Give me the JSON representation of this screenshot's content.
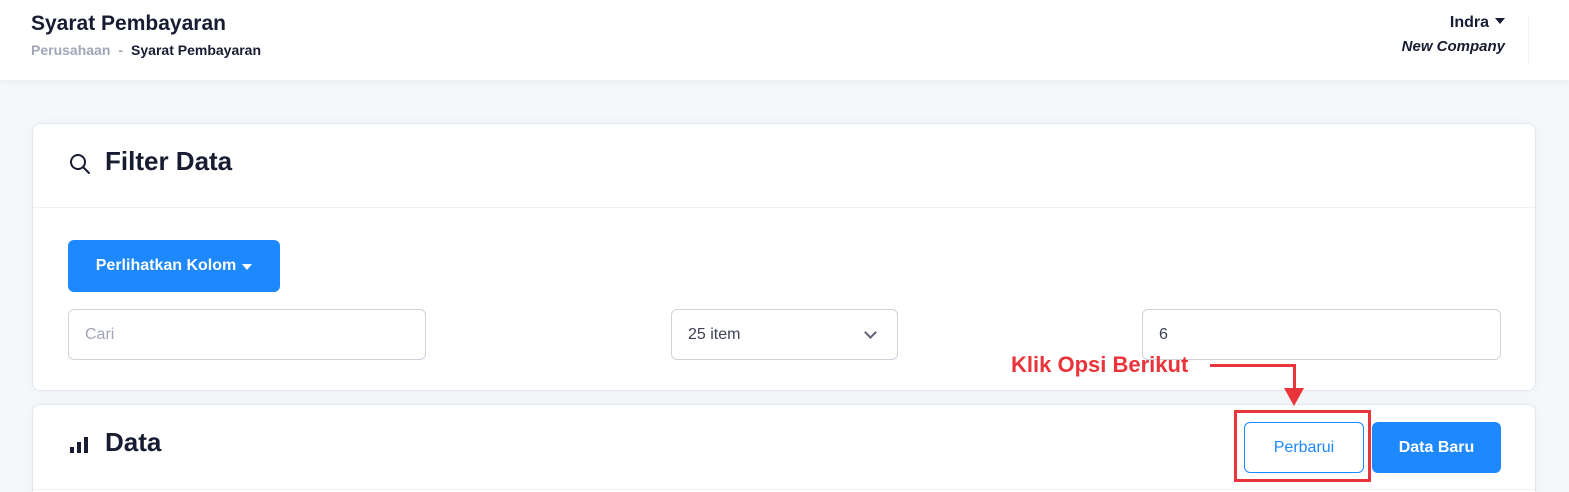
{
  "header": {
    "title": "Syarat Pembayaran",
    "breadcrumb": {
      "parent": "Perusahaan",
      "separator": "-",
      "current": "Syarat Pembayaran"
    },
    "user": {
      "name": "Indra",
      "company": "New Company"
    }
  },
  "filter": {
    "title": "Filter Data",
    "icon": "search-icon",
    "columns_button": "Perlihatkan Kolom",
    "search": {
      "placeholder": "Cari",
      "value": ""
    },
    "page_size": {
      "selected": "25 item"
    },
    "page_number": {
      "value": "6"
    }
  },
  "data_section": {
    "title": "Data",
    "icon": "bar-chart-icon",
    "refresh_button": "Perbarui",
    "new_button": "Data Baru"
  },
  "annotation": {
    "text": "Klik Opsi Berikut",
    "color": "#e8343a"
  },
  "colors": {
    "primary": "#1e88ff",
    "title": "#181c32",
    "muted": "#a1a5b7"
  }
}
